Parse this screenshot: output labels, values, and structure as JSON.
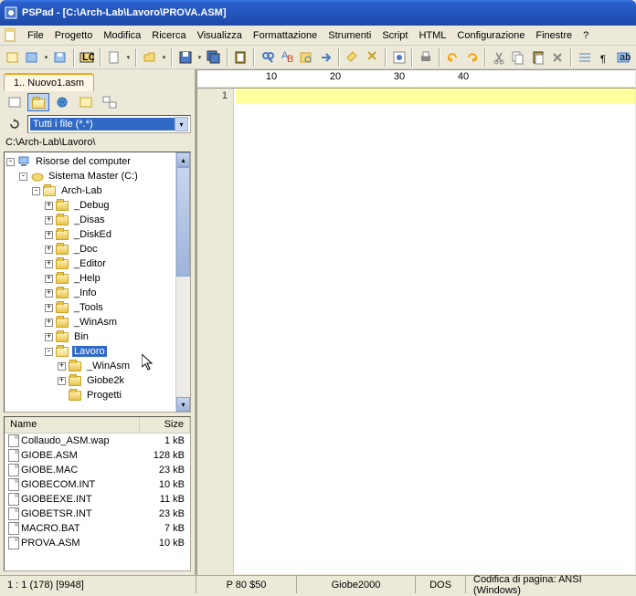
{
  "title": "PSPad - [C:\\Arch-Lab\\Lavoro\\PROVA.ASM]",
  "menu": [
    "File",
    "Progetto",
    "Modifica",
    "Ricerca",
    "Visualizza",
    "Formattazione",
    "Strumenti",
    "Script",
    "HTML",
    "Configurazione",
    "Finestre",
    "?"
  ],
  "tab": "1.. Nuovo1.asm",
  "filter": "Tutti i file (*.*)",
  "path": "C:\\Arch-Lab\\Lavoro\\",
  "tree": {
    "root": "Risorse del computer",
    "drive": "Sistema Master (C:)",
    "l1": "Arch-Lab",
    "folders": [
      "_Debug",
      "_Disas",
      "_DiskEd",
      "_Doc",
      "_Editor",
      "_Help",
      "_Info",
      "_Tools",
      "_WinAsm",
      "Bin"
    ],
    "selected": "Lavoro",
    "sub": [
      "_WinAsm",
      "Giobe2k",
      "Progetti"
    ]
  },
  "filelist": {
    "headers": {
      "name": "Name",
      "size": "Size"
    },
    "rows": [
      {
        "n": "Collaudo_ASM.wap",
        "s": "1 kB"
      },
      {
        "n": "GIOBE.ASM",
        "s": "128 kB"
      },
      {
        "n": "GIOBE.MAC",
        "s": "23 kB"
      },
      {
        "n": "GIOBECOM.INT",
        "s": "10 kB"
      },
      {
        "n": "GIOBEEXE.INT",
        "s": "11 kB"
      },
      {
        "n": "GIOBETSR.INT",
        "s": "23 kB"
      },
      {
        "n": "MACRO.BAT",
        "s": "7 kB"
      },
      {
        "n": "PROVA.ASM",
        "s": "10 kB"
      }
    ]
  },
  "ruler": [
    "10",
    "20",
    "30",
    "40"
  ],
  "linenum": "1",
  "status": {
    "pos": "1 : 1  (178)  [9948]",
    "p": "P  80  $50",
    "name": "Giobe2000",
    "dos": "DOS",
    "enc": "Codifica di pagina: ANSI (Windows)"
  }
}
